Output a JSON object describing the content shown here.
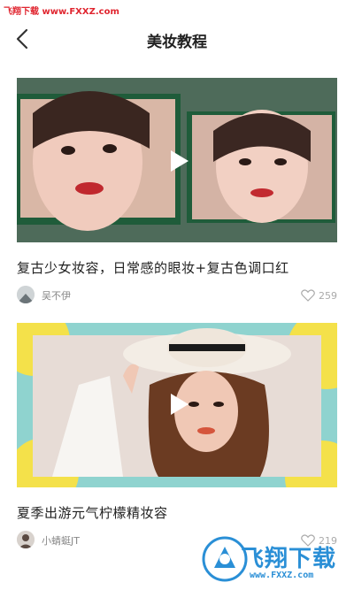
{
  "watermark": "飞翔下载 www.FXXZ.com",
  "header": {
    "title": "美妆教程"
  },
  "cards": [
    {
      "title": "复古少女妆容，日常感的眼妆+复古色调口红",
      "author": "吴不伊",
      "likes": "259"
    },
    {
      "title": "夏季出游元气柠檬精妆容",
      "author": "小蜻蜓JT",
      "likes": "219"
    }
  ],
  "brand": {
    "name": "飞翔下载",
    "url": "www.FXXZ.com"
  },
  "colors": {
    "accent": "#2a8fd6",
    "watermark_red": "#e0252f",
    "card1_bg": "#4c6a58",
    "card2_bg": "#7ec9c9"
  },
  "icons": {
    "back": "back-arrow-icon",
    "play": "play-icon",
    "like": "heart-icon"
  }
}
